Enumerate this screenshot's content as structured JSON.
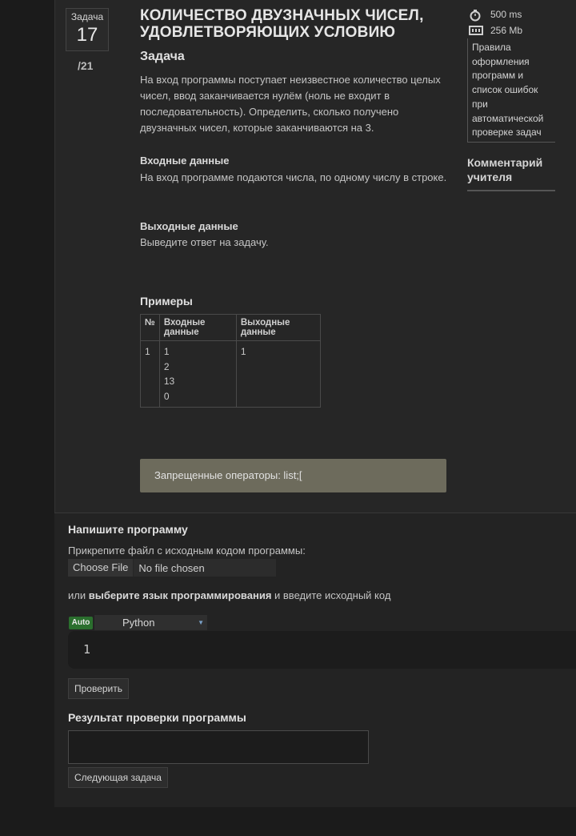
{
  "task": {
    "label": "Задача",
    "number": "17",
    "total": "/21",
    "title": "КОЛИЧЕСТВО ДВУЗНАЧНЫХ ЧИСЕЛ, УДОВЛЕТВОРЯЮЩИХ УСЛОВИЮ"
  },
  "statement": {
    "heading": "Задача",
    "text": "На вход программы поступает неизвестное количество целых чисел, ввод заканчивается нулём (ноль не входит в последовательность). Определить, сколько получено двузначных чисел, которые заканчиваются на 3.",
    "input_heading": "Входные данные",
    "input_text": "На вход программе подаются числа, по одному числу в строке.",
    "output_heading": "Выходные данные",
    "output_text": "Выведите ответ на задачу."
  },
  "examples": {
    "heading": "Примеры",
    "columns": [
      "№",
      "Входные данные",
      "Выходные данные"
    ],
    "rows": [
      {
        "n": "1",
        "input": [
          "1",
          "2",
          "13",
          "0"
        ],
        "output": "1"
      }
    ]
  },
  "forbidden": "Запрещенные операторы: list;[",
  "sidebar": {
    "time_limit": "500 ms",
    "memory_limit": "256 Mb",
    "rules_link": "Правила оформления программ и список ошибок при автоматической проверке задач",
    "teacher_comment": "Комментарий учителя"
  },
  "submit": {
    "heading": "Напишите программу",
    "attach_text": "Прикрепите файл с исходным кодом программы:",
    "choose_file": "Choose File",
    "no_file": "No file chosen",
    "or_text": "или",
    "choose_lang_bold": "выберите язык программирования",
    "enter_code_text": "и введите исходный код",
    "auto_badge": "Auto",
    "language": "Python",
    "line_number": "1",
    "check_button": "Проверить",
    "result_heading": "Результат проверки программы",
    "next_button": "Следующая задача"
  },
  "colors": {
    "background": "#1b1b1b",
    "panel": "#262626",
    "forbidden_bg": "#6d6b5c",
    "auto_badge": "#2b6f2e"
  }
}
